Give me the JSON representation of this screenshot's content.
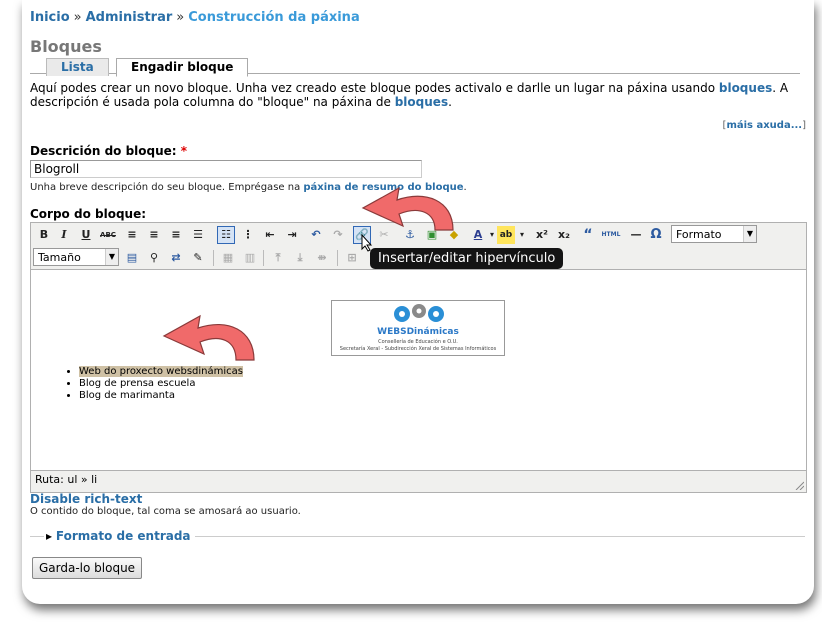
{
  "breadcrumb": [
    "Inicio",
    "Administrar",
    "Construcción da páxina"
  ],
  "breadcrumb_separator": "»",
  "page_title": "Bloques",
  "tabs": [
    {
      "label": "Lista",
      "active": false
    },
    {
      "label": "Engadir bloque",
      "active": true
    }
  ],
  "intro": {
    "part1": "Aquí podes crear un novo bloque. Unha vez creado este bloque podes activalo e darlle un lugar na páxina usando ",
    "link1": "bloques",
    "part2": ". A descripción é usada pola columna do \"bloque\" na páxina de ",
    "link2": "bloques",
    "part3": "."
  },
  "more_help": {
    "open": "[",
    "label": "máis axuda...",
    "close": "]"
  },
  "description_field": {
    "label": "Descrición do bloque:",
    "required_mark": "*",
    "value": "Blogroll",
    "help_prefix": "Unha breve descripción do seu bloque. Emprégase na ",
    "help_link": "páxina de resumo do bloque",
    "help_suffix": "."
  },
  "body_field": {
    "label": "Corpo do bloque:"
  },
  "toolbar": {
    "row1": [
      "B",
      "I",
      "U",
      "ABC"
    ],
    "format_select": "Formato",
    "size_select": "Tamaño",
    "html_label": "HTML",
    "sup_label": "x²",
    "sub_label": "x₂",
    "quote_label": "“",
    "omega_label": "Ω"
  },
  "content": {
    "logo_title": "WEBSDinámicas",
    "logo_line1": "Consellería de Educación e O.U.",
    "logo_line2": "Secretaría Xeral - Subdirección Xeral de Sistemas Informáticos",
    "list": [
      "Web do proxecto websdinámicas",
      "Blog de prensa escuela",
      "Blog de marimanta"
    ]
  },
  "status_path": "Ruta: ul » li",
  "tooltip": "Insertar/editar hipervínculo",
  "disable_rich_text": "Disable rich-text",
  "body_help": "O contido do bloque, tal coma se amosará ao usuario.",
  "input_format": {
    "toggle": "▸",
    "label": "Formato de entrada"
  },
  "save_button": "Garda-lo bloque",
  "colors": {
    "link": "#2a6ea6",
    "highlight": "#cfc1a5",
    "arrow": "#f06a6a"
  }
}
